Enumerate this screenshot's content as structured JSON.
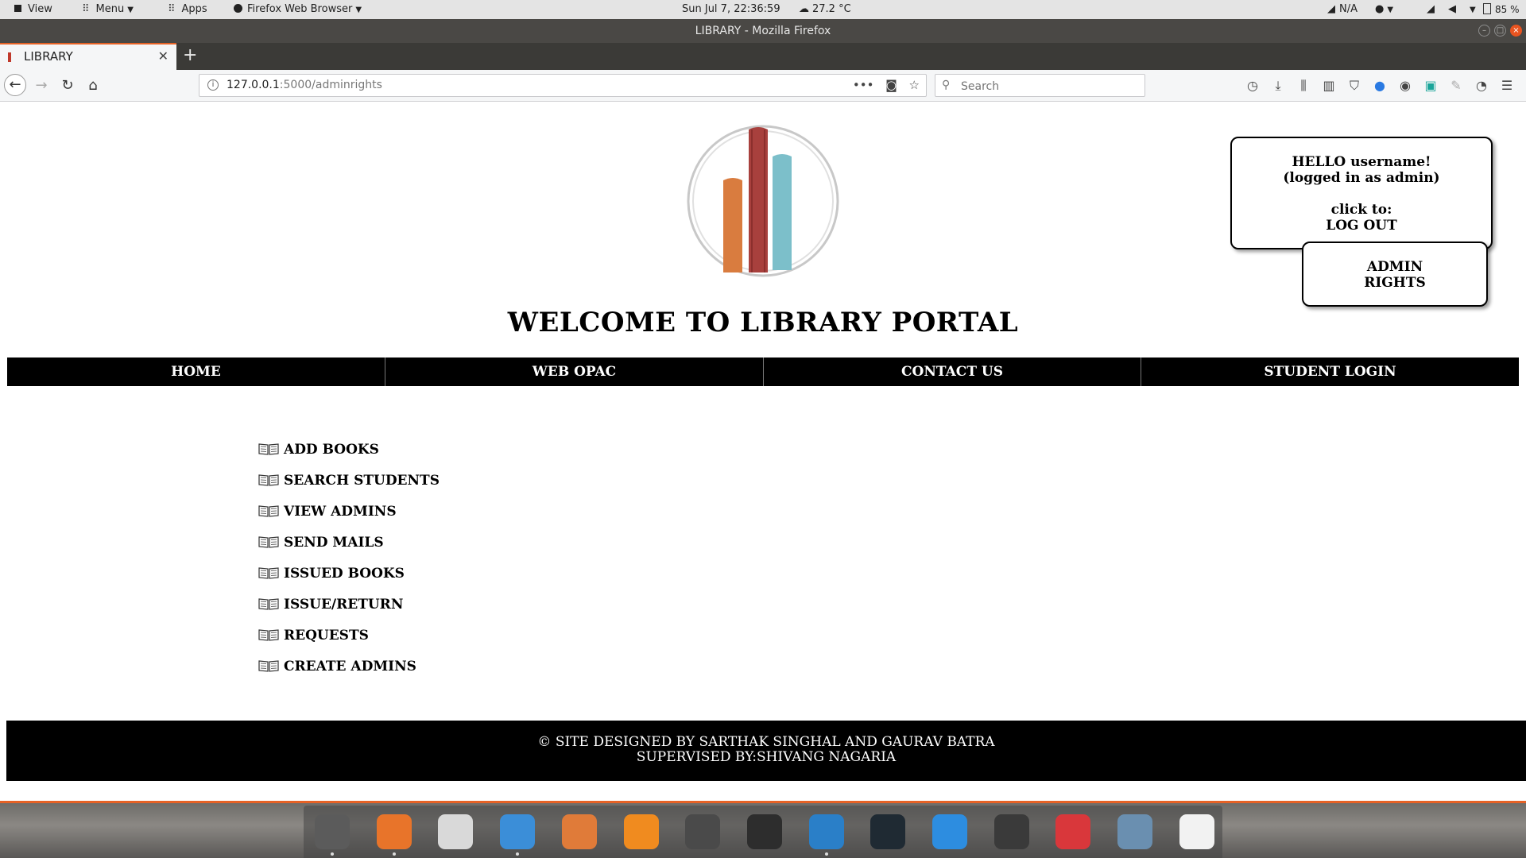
{
  "os_panel": {
    "view_label": "View",
    "menu_label": "Menu",
    "apps_label": "Apps",
    "active_app": "Firefox Web Browser",
    "datetime": "Sun Jul  7, 22:36:59",
    "weather": "27.2 °C",
    "network": "N/A",
    "battery": "85 %"
  },
  "browser": {
    "window_title": "LIBRARY - Mozilla Firefox",
    "tab_title": "LIBRARY",
    "url_host": "127.0.0.1",
    "url_rest": ":5000/adminrights",
    "search_placeholder": "Search",
    "colors": {
      "accent": "#e66226",
      "titlebar": "#4a4845"
    }
  },
  "header": {
    "title": "WELCOME TO LIBRARY PORTAL",
    "logo_colors": [
      "#d97c3f",
      "#a8403d",
      "#7cbfca"
    ]
  },
  "user_box": {
    "greeting": "HELLO username!",
    "role": "(logged in as admin)",
    "click_to": "click to:",
    "logout": "LOG OUT"
  },
  "admin_rights": {
    "line1": "ADMIN",
    "line2": "RIGHTS"
  },
  "nav": [
    {
      "label": "HOME"
    },
    {
      "label": "WEB OPAC"
    },
    {
      "label": "CONTACT US"
    },
    {
      "label": "STUDENT LOGIN"
    }
  ],
  "admin_menu": [
    {
      "label": "ADD BOOKS"
    },
    {
      "label": "SEARCH STUDENTS"
    },
    {
      "label": "VIEW ADMINS"
    },
    {
      "label": "SEND MAILS"
    },
    {
      "label": "ISSUED BOOKS"
    },
    {
      "label": "ISSUE/RETURN"
    },
    {
      "label": "REQUESTS"
    },
    {
      "label": "CREATE ADMINS"
    }
  ],
  "footer": {
    "line1": "© SITE DESIGNED BY SARTHAK SINGHAL AND GAURAV BATRA",
    "line2": "SUPERVISED BY:SHIVANG NAGARIA"
  },
  "dock_icons": [
    {
      "name": "system-settings-icon",
      "color": "#5b5b5b"
    },
    {
      "name": "firefox-icon",
      "color": "#e8742a"
    },
    {
      "name": "downloader-icon",
      "color": "#d9d9d9"
    },
    {
      "name": "finder-icon",
      "color": "#3b8ed8"
    },
    {
      "name": "gimp-icon",
      "color": "#e07b39"
    },
    {
      "name": "vlc-icon",
      "color": "#f08b1f"
    },
    {
      "name": "settings-gear-icon",
      "color": "#4a4a4a"
    },
    {
      "name": "terminal-icon",
      "color": "#2d2d2d"
    },
    {
      "name": "vscode-icon",
      "color": "#2a7fc8"
    },
    {
      "name": "stacer-icon",
      "color": "#1f2a33"
    },
    {
      "name": "preferences-icon",
      "color": "#2d8de0"
    },
    {
      "name": "keyboard-icon",
      "color": "#3a3a3a"
    },
    {
      "name": "help-icon",
      "color": "#d9373b"
    },
    {
      "name": "database-icon",
      "color": "#6a8fb0"
    },
    {
      "name": "xmind-icon",
      "color": "#f2f2f2"
    }
  ]
}
